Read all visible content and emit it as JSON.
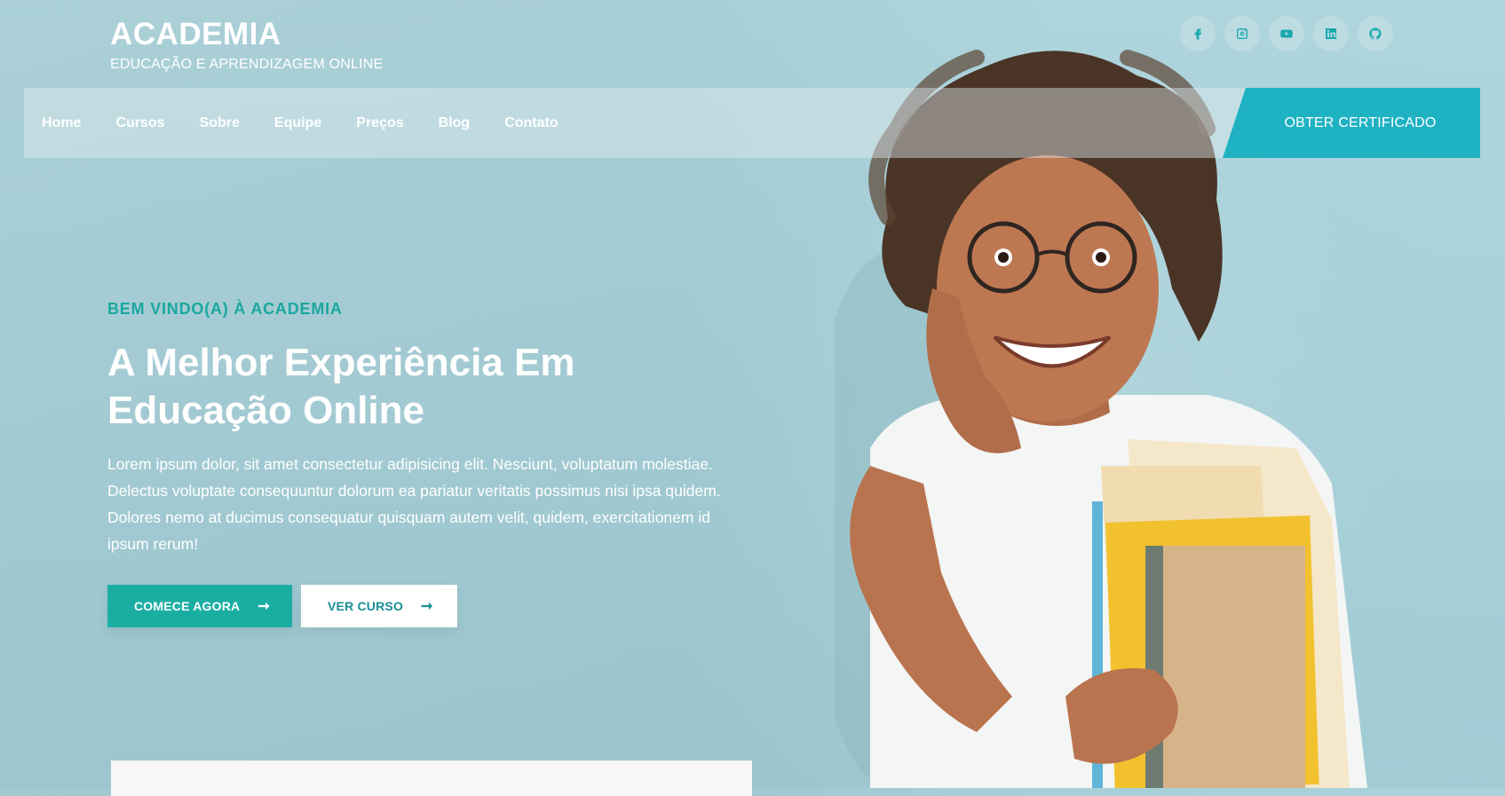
{
  "brand": {
    "title": "ACADEMIA",
    "subtitle": "EDUCAÇÃO E APRENDIZAGEM ONLINE"
  },
  "social": [
    {
      "icon": "facebook-icon"
    },
    {
      "icon": "instagram-icon"
    },
    {
      "icon": "youtube-icon"
    },
    {
      "icon": "linkedin-icon"
    },
    {
      "icon": "github-icon"
    }
  ],
  "nav": {
    "items": [
      "Home",
      "Cursos",
      "Sobre",
      "Equipe",
      "Preços",
      "Blog",
      "Contato"
    ],
    "cta": "OBTER CERTIFICADO"
  },
  "hero": {
    "kicker": "BEM VINDO(A) À ACADEMIA",
    "headline_line1": "A Melhor Experiência Em",
    "headline_line2": "Educação Online",
    "description": "Lorem ipsum dolor, sit amet consectetur adipisicing elit. Nesciunt, voluptatum molestiae. Delectus voluptate consequuntur dolorum ea pariatur veritatis possimus nisi ipsa quidem. Dolores nemo at ducimus consequatur quisquam autem velit, quidem, exercitationem id ipsum rerum!",
    "primary_button": "COMECE AGORA",
    "secondary_button": "VER CURSO"
  },
  "colors": {
    "accent": "#1aaea3",
    "cta": "#1eb2c3",
    "kicker": "#1aa7a0"
  }
}
